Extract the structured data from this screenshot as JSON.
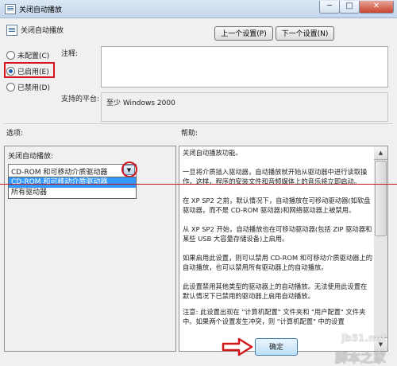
{
  "window": {
    "title": "关闭自动播放",
    "minimize": "─",
    "maximize": "□",
    "close": "✕"
  },
  "policy": {
    "name": "关闭自动播放",
    "prev_button": "上一个设置(P)",
    "next_button": "下一个设置(N)"
  },
  "options": {
    "not_configured": "未配置(C)",
    "enabled": "已启用(E)",
    "disabled": "已禁用(D)",
    "selected": "enabled"
  },
  "comment_label": "注释:",
  "supported_label": "支持的平台:",
  "supported_value": "至少 Windows 2000",
  "options_header": "选项:",
  "help_header": "帮助:",
  "setting": {
    "label": "关闭自动播放:",
    "selected_value": "CD-ROM 和可移动介质驱动器",
    "dropdown_options": [
      "CD-ROM 和可移动介质驱动器",
      "所有驱动器"
    ]
  },
  "help_text": [
    "关闭自动播放功能。",
    "一旦将介质插入驱动器，自动播放就开始从驱动器中进行读取操作，这样，程序的安装文件和音频媒体上的音乐将立即启动。",
    "在 XP SP2 之前，默认情况下，自动播放在可移动驱动器(如软盘驱动器，而不是 CD-ROM 驱动器)和网络驱动器上被禁用。",
    "从 XP SP2 开始，自动播放也在可移动驱动器(包括 ZIP 驱动器和某些 USB 大容量存储设备)上启用。",
    "如果启用此设置，则可以禁用 CD-ROM 和可移动介质驱动器上的自动播放，也可以禁用所有驱动器上的自动播放。",
    "此设置禁用其他类型的驱动器上的自动播放。无法使用此设置在默认情况下已禁用的驱动器上启用自动播放。",
    "注意: 此设置出现在 \"计算机配置\" 文件夹和 \"用户配置\" 文件夹中。如果两个设置发生冲突，则 \"计算机配置\" 中的设置"
  ],
  "ok_button": "确定",
  "watermark": {
    "url": "jb51.net",
    "cn": "脚本之家"
  },
  "colors": {
    "highlight_red": "#d3141b",
    "selection_blue": "#3399ff"
  }
}
